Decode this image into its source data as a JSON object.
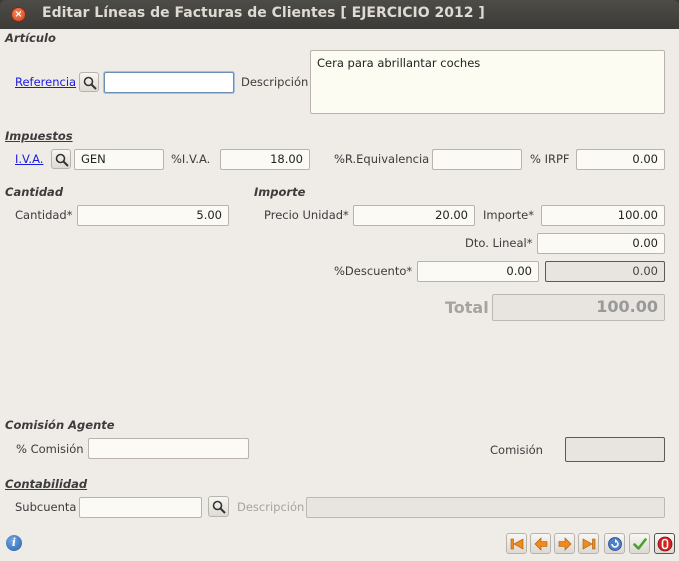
{
  "window": {
    "title": "Editar Líneas de Facturas de Clientes [ EJERCICIO 2012 ]"
  },
  "articulo": {
    "section": "Artículo",
    "referencia_link": "Referencia",
    "referencia_value": "",
    "descripcion_label": "Descripción",
    "descripcion_value": "Cera para abrillantar coches"
  },
  "impuestos": {
    "section": "Impuestos",
    "iva_link": "I.V.A.",
    "iva_value": "GEN",
    "pct_iva_label": "%I.V.A.",
    "pct_iva_value": "18.00",
    "req_label": "%R.Equivalencia",
    "req_value": "",
    "irpf_label": "% IRPF",
    "irpf_value": "0.00"
  },
  "cantidad": {
    "section": "Cantidad",
    "label": "Cantidad*",
    "value": "5.00"
  },
  "importe": {
    "section": "Importe",
    "precio_label": "Precio Unidad*",
    "precio_value": "20.00",
    "importe_label": "Importe*",
    "importe_value": "100.00",
    "dto_label": "Dto. Lineal*",
    "dto_value": "0.00",
    "pct_desc_label": "%Descuento*",
    "pct_desc_value": "0.00",
    "desc_amount": "0.00",
    "total_label": "Total",
    "total_value": "100.00"
  },
  "comision": {
    "section": "Comisión Agente",
    "pct_label": "% Comisión",
    "pct_value": "",
    "amount_label": "Comisión",
    "amount_value": ""
  },
  "contabilidad": {
    "section": "Contabilidad",
    "subcuenta_label": "Subcuenta",
    "subcuenta_value": "",
    "desc_label": "Descripción",
    "desc_value": ""
  },
  "colors": {
    "accent_orange": "#f08a1c",
    "accept_green": "#4aa02c",
    "cancel_red": "#d42020",
    "link_blue": "#1a1ae0"
  }
}
